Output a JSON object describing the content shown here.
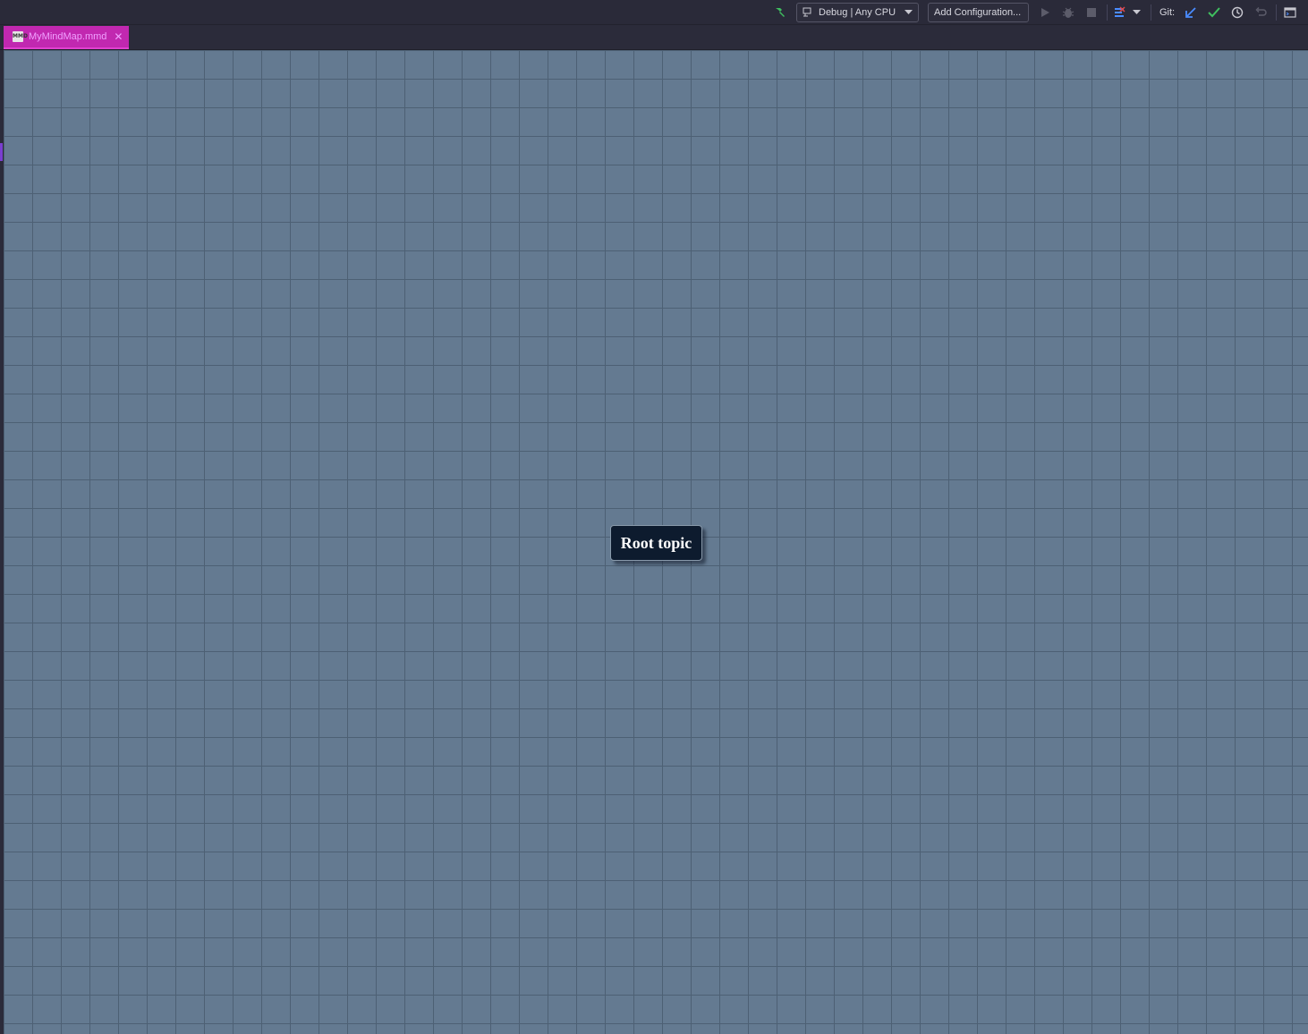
{
  "toolbar": {
    "config_selector": "Debug | Any CPU",
    "add_configuration": "Add Configuration...",
    "git_label": "Git:",
    "icons": {
      "build": "hammer-icon",
      "run": "play-icon",
      "debug": "bug-icon",
      "stop": "stop-icon",
      "coverage": "coverage-icon",
      "git_update": "arrow-down-left-icon",
      "git_commit": "checkmark-icon",
      "git_history": "clock-icon",
      "git_rollback": "undo-icon",
      "layout": "window-icon"
    }
  },
  "tabs": [
    {
      "title": "MyMindMap.mmd",
      "icon_text": "MMD",
      "active": true
    }
  ],
  "mindmap": {
    "root_topic": "Root topic"
  },
  "colors": {
    "tab_active": "#c128b0",
    "canvas_bg": "#647a91",
    "grid_line": "#4d6074",
    "node_bg": "#0d1b2e",
    "build_icon": "#3fbf5f",
    "git_update": "#4a8cff",
    "git_commit": "#3fbf5f"
  }
}
